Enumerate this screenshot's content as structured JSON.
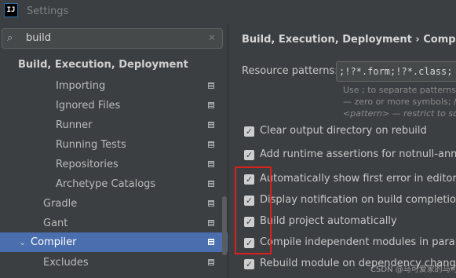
{
  "window": {
    "title": "Settings",
    "app_icon_label": "IJ"
  },
  "search": {
    "value": "build"
  },
  "tree": {
    "section_header": "Build, Execution, Deployment",
    "items": [
      {
        "label": "Importing"
      },
      {
        "label": "Ignored Files"
      },
      {
        "label": "Runner"
      },
      {
        "label": "Running Tests"
      },
      {
        "label": "Repositories"
      },
      {
        "label": "Archetype Catalogs"
      },
      {
        "label": "Gradle"
      },
      {
        "label": "Gant"
      },
      {
        "label": "Compiler",
        "selected": true
      },
      {
        "label": "Excludes"
      }
    ]
  },
  "header": {
    "breadcrumb": "Build, Execution, Deployment  ›  Compiler"
  },
  "resource_patterns": {
    "label": "Resource patterns:",
    "value": ";!?*.form;!?*.class;",
    "hint_lines": [
      "Use ; to separate patterns and",
      "— zero or more symbols; / —",
      "<pattern> — restrict to sou"
    ]
  },
  "options": [
    {
      "label": "Clear output directory on rebuild",
      "checked": true
    },
    {
      "label": "Add runtime assertions for notnull-annotate",
      "checked": true
    },
    {
      "label": "Automatically show first error in editor",
      "checked": true
    },
    {
      "label": "Display notification on build completion",
      "checked": true
    },
    {
      "label": "Build project automatically",
      "checked": true
    },
    {
      "label": "Compile independent modules in parallel",
      "checked": true
    },
    {
      "label": "Rebuild module on dependency change",
      "checked": true
    }
  ],
  "watermark": "CSDN @马可爱家的马可爱",
  "colors": {
    "selection": "#4b6eaf",
    "highlight_box": "#d9201c",
    "background": "#3c3f41"
  }
}
